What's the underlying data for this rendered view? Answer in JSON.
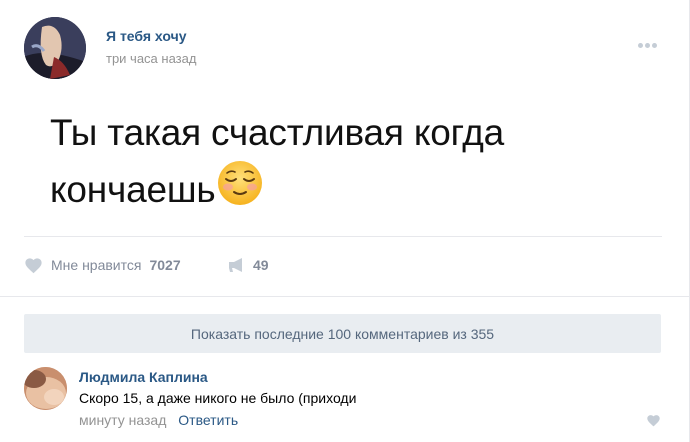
{
  "post": {
    "author": "Я тебя хочу",
    "time": "три часа назад",
    "text": "Ты такая счастливая когда кончаешь",
    "emoji": "relieved-face-emoji"
  },
  "actions": {
    "like_label": "Мне нравится",
    "like_count": "7027",
    "share_count": "49"
  },
  "comments": {
    "show_more": "Показать последние 100 комментариев из 355",
    "items": [
      {
        "author": "Людмила Каплина",
        "text": "Скоро 15, а даже никого не было (приходи",
        "time": "минуту назад",
        "reply_label": "Ответить"
      }
    ]
  },
  "colors": {
    "link": "#2a5885",
    "muted": "#939393",
    "icon": "#c5cdd6",
    "button_bg": "#e9edf1"
  }
}
